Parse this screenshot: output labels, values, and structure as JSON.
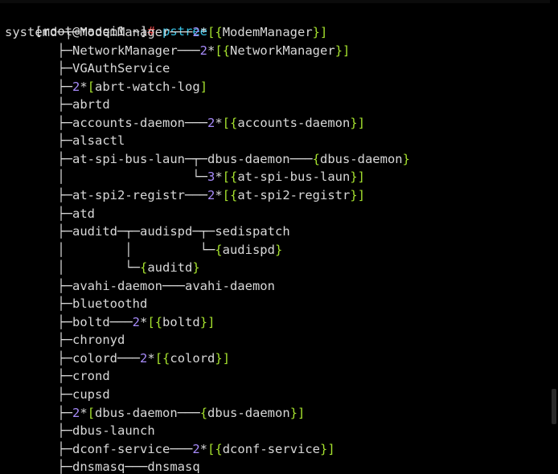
{
  "prompt": {
    "user_host": "[root@maoqi1 ~]",
    "symbol": "#",
    "command": "pstree"
  },
  "tree_lines": [
    [
      {
        "t": "systemd",
        "c": "proc"
      },
      {
        "t": "─┬─",
        "c": "tree"
      },
      {
        "t": "ModemManager",
        "c": "proc"
      },
      {
        "t": "───",
        "c": "tree"
      },
      {
        "t": "2",
        "c": "count"
      },
      {
        "t": "*",
        "c": "tree"
      },
      {
        "t": "[",
        "c": "bracket"
      },
      {
        "t": "{",
        "c": "bracket"
      },
      {
        "t": "ModemManager",
        "c": "proc"
      },
      {
        "t": "}",
        "c": "bracket"
      },
      {
        "t": "]",
        "c": "bracket"
      }
    ],
    [
      {
        "t": "       ├─",
        "c": "tree"
      },
      {
        "t": "NetworkManager",
        "c": "proc"
      },
      {
        "t": "───",
        "c": "tree"
      },
      {
        "t": "2",
        "c": "count"
      },
      {
        "t": "*",
        "c": "tree"
      },
      {
        "t": "[",
        "c": "bracket"
      },
      {
        "t": "{",
        "c": "bracket"
      },
      {
        "t": "NetworkManager",
        "c": "proc"
      },
      {
        "t": "}",
        "c": "bracket"
      },
      {
        "t": "]",
        "c": "bracket"
      }
    ],
    [
      {
        "t": "       ├─",
        "c": "tree"
      },
      {
        "t": "VGAuthService",
        "c": "proc"
      }
    ],
    [
      {
        "t": "       ├─",
        "c": "tree"
      },
      {
        "t": "2",
        "c": "count"
      },
      {
        "t": "*",
        "c": "tree"
      },
      {
        "t": "[",
        "c": "bracket"
      },
      {
        "t": "abrt-watch-log",
        "c": "proc"
      },
      {
        "t": "]",
        "c": "bracket"
      }
    ],
    [
      {
        "t": "       ├─",
        "c": "tree"
      },
      {
        "t": "abrtd",
        "c": "proc"
      }
    ],
    [
      {
        "t": "       ├─",
        "c": "tree"
      },
      {
        "t": "accounts-daemon",
        "c": "proc"
      },
      {
        "t": "───",
        "c": "tree"
      },
      {
        "t": "2",
        "c": "count"
      },
      {
        "t": "*",
        "c": "tree"
      },
      {
        "t": "[",
        "c": "bracket"
      },
      {
        "t": "{",
        "c": "bracket"
      },
      {
        "t": "accounts-daemon",
        "c": "proc"
      },
      {
        "t": "}",
        "c": "bracket"
      },
      {
        "t": "]",
        "c": "bracket"
      }
    ],
    [
      {
        "t": "       ├─",
        "c": "tree"
      },
      {
        "t": "alsactl",
        "c": "proc"
      }
    ],
    [
      {
        "t": "       ├─",
        "c": "tree"
      },
      {
        "t": "at-spi-bus-laun",
        "c": "proc"
      },
      {
        "t": "─┬─",
        "c": "tree"
      },
      {
        "t": "dbus-daemon",
        "c": "proc"
      },
      {
        "t": "───",
        "c": "tree"
      },
      {
        "t": "{",
        "c": "bracket"
      },
      {
        "t": "dbus-daemon",
        "c": "proc"
      },
      {
        "t": "}",
        "c": "bracket"
      }
    ],
    [
      {
        "t": "       │                 └─",
        "c": "tree"
      },
      {
        "t": "3",
        "c": "count"
      },
      {
        "t": "*",
        "c": "tree"
      },
      {
        "t": "[",
        "c": "bracket"
      },
      {
        "t": "{",
        "c": "bracket"
      },
      {
        "t": "at-spi-bus-laun",
        "c": "proc"
      },
      {
        "t": "}",
        "c": "bracket"
      },
      {
        "t": "]",
        "c": "bracket"
      }
    ],
    [
      {
        "t": "       ├─",
        "c": "tree"
      },
      {
        "t": "at-spi2-registr",
        "c": "proc"
      },
      {
        "t": "───",
        "c": "tree"
      },
      {
        "t": "2",
        "c": "count"
      },
      {
        "t": "*",
        "c": "tree"
      },
      {
        "t": "[",
        "c": "bracket"
      },
      {
        "t": "{",
        "c": "bracket"
      },
      {
        "t": "at-spi2-registr",
        "c": "proc"
      },
      {
        "t": "}",
        "c": "bracket"
      },
      {
        "t": "]",
        "c": "bracket"
      }
    ],
    [
      {
        "t": "       ├─",
        "c": "tree"
      },
      {
        "t": "atd",
        "c": "proc"
      }
    ],
    [
      {
        "t": "       ├─",
        "c": "tree"
      },
      {
        "t": "auditd",
        "c": "proc"
      },
      {
        "t": "─┬─",
        "c": "tree"
      },
      {
        "t": "audispd",
        "c": "proc"
      },
      {
        "t": "─┬─",
        "c": "tree"
      },
      {
        "t": "sedispatch",
        "c": "proc"
      }
    ],
    [
      {
        "t": "       │        │         └─",
        "c": "tree"
      },
      {
        "t": "{",
        "c": "bracket"
      },
      {
        "t": "audispd",
        "c": "proc"
      },
      {
        "t": "}",
        "c": "bracket"
      }
    ],
    [
      {
        "t": "       │        └─",
        "c": "tree"
      },
      {
        "t": "{",
        "c": "bracket"
      },
      {
        "t": "auditd",
        "c": "proc"
      },
      {
        "t": "}",
        "c": "bracket"
      }
    ],
    [
      {
        "t": "       ├─",
        "c": "tree"
      },
      {
        "t": "avahi-daemon",
        "c": "proc"
      },
      {
        "t": "───",
        "c": "tree"
      },
      {
        "t": "avahi-daemon",
        "c": "proc"
      }
    ],
    [
      {
        "t": "       ├─",
        "c": "tree"
      },
      {
        "t": "bluetoothd",
        "c": "proc"
      }
    ],
    [
      {
        "t": "       ├─",
        "c": "tree"
      },
      {
        "t": "boltd",
        "c": "proc"
      },
      {
        "t": "───",
        "c": "tree"
      },
      {
        "t": "2",
        "c": "count"
      },
      {
        "t": "*",
        "c": "tree"
      },
      {
        "t": "[",
        "c": "bracket"
      },
      {
        "t": "{",
        "c": "bracket"
      },
      {
        "t": "boltd",
        "c": "proc"
      },
      {
        "t": "}",
        "c": "bracket"
      },
      {
        "t": "]",
        "c": "bracket"
      }
    ],
    [
      {
        "t": "       ├─",
        "c": "tree"
      },
      {
        "t": "chronyd",
        "c": "proc"
      }
    ],
    [
      {
        "t": "       ├─",
        "c": "tree"
      },
      {
        "t": "colord",
        "c": "proc"
      },
      {
        "t": "───",
        "c": "tree"
      },
      {
        "t": "2",
        "c": "count"
      },
      {
        "t": "*",
        "c": "tree"
      },
      {
        "t": "[",
        "c": "bracket"
      },
      {
        "t": "{",
        "c": "bracket"
      },
      {
        "t": "colord",
        "c": "proc"
      },
      {
        "t": "}",
        "c": "bracket"
      },
      {
        "t": "]",
        "c": "bracket"
      }
    ],
    [
      {
        "t": "       ├─",
        "c": "tree"
      },
      {
        "t": "crond",
        "c": "proc"
      }
    ],
    [
      {
        "t": "       ├─",
        "c": "tree"
      },
      {
        "t": "cupsd",
        "c": "proc"
      }
    ],
    [
      {
        "t": "       ├─",
        "c": "tree"
      },
      {
        "t": "2",
        "c": "count"
      },
      {
        "t": "*",
        "c": "tree"
      },
      {
        "t": "[",
        "c": "bracket"
      },
      {
        "t": "dbus-daemon",
        "c": "proc"
      },
      {
        "t": "───",
        "c": "tree"
      },
      {
        "t": "{",
        "c": "bracket"
      },
      {
        "t": "dbus-daemon",
        "c": "proc"
      },
      {
        "t": "}",
        "c": "bracket"
      },
      {
        "t": "]",
        "c": "bracket"
      }
    ],
    [
      {
        "t": "       ├─",
        "c": "tree"
      },
      {
        "t": "dbus-launch",
        "c": "proc"
      }
    ],
    [
      {
        "t": "       ├─",
        "c": "tree"
      },
      {
        "t": "dconf-service",
        "c": "proc"
      },
      {
        "t": "───",
        "c": "tree"
      },
      {
        "t": "2",
        "c": "count"
      },
      {
        "t": "*",
        "c": "tree"
      },
      {
        "t": "[",
        "c": "bracket"
      },
      {
        "t": "{",
        "c": "bracket"
      },
      {
        "t": "dconf-service",
        "c": "proc"
      },
      {
        "t": "}",
        "c": "bracket"
      },
      {
        "t": "]",
        "c": "bracket"
      }
    ],
    [
      {
        "t": "       ├─",
        "c": "tree"
      },
      {
        "t": "dnsmasq",
        "c": "proc"
      },
      {
        "t": "───",
        "c": "tree"
      },
      {
        "t": "dnsmasq",
        "c": "proc"
      }
    ]
  ]
}
